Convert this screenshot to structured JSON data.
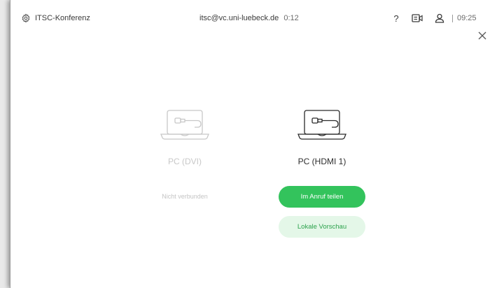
{
  "header": {
    "room_name": "ITSC-Konferenz",
    "call_address": "itsc@vc.uni-luebeck.de",
    "call_timer": "0:12",
    "help_symbol": "?",
    "clock": "09:25",
    "icons": [
      "gear-icon",
      "question-icon",
      "camera-icon",
      "user-icon",
      "close-icon"
    ]
  },
  "sources": [
    {
      "name": "PC (DVI)",
      "status": "Nicht verbunden",
      "icon": "laptop-hdmi-icon"
    },
    {
      "name": "PC (HDMI 1)",
      "icon": "laptop-hdmi-icon",
      "share_label": "Im Anruf teilen",
      "preview_label": "Lokale Vorschau"
    }
  ],
  "colors": {
    "accent": "#33c35c",
    "accent_soft": "#e4f7e8",
    "accent_text": "#2ca24c",
    "disabled": "#c8c8c8"
  }
}
